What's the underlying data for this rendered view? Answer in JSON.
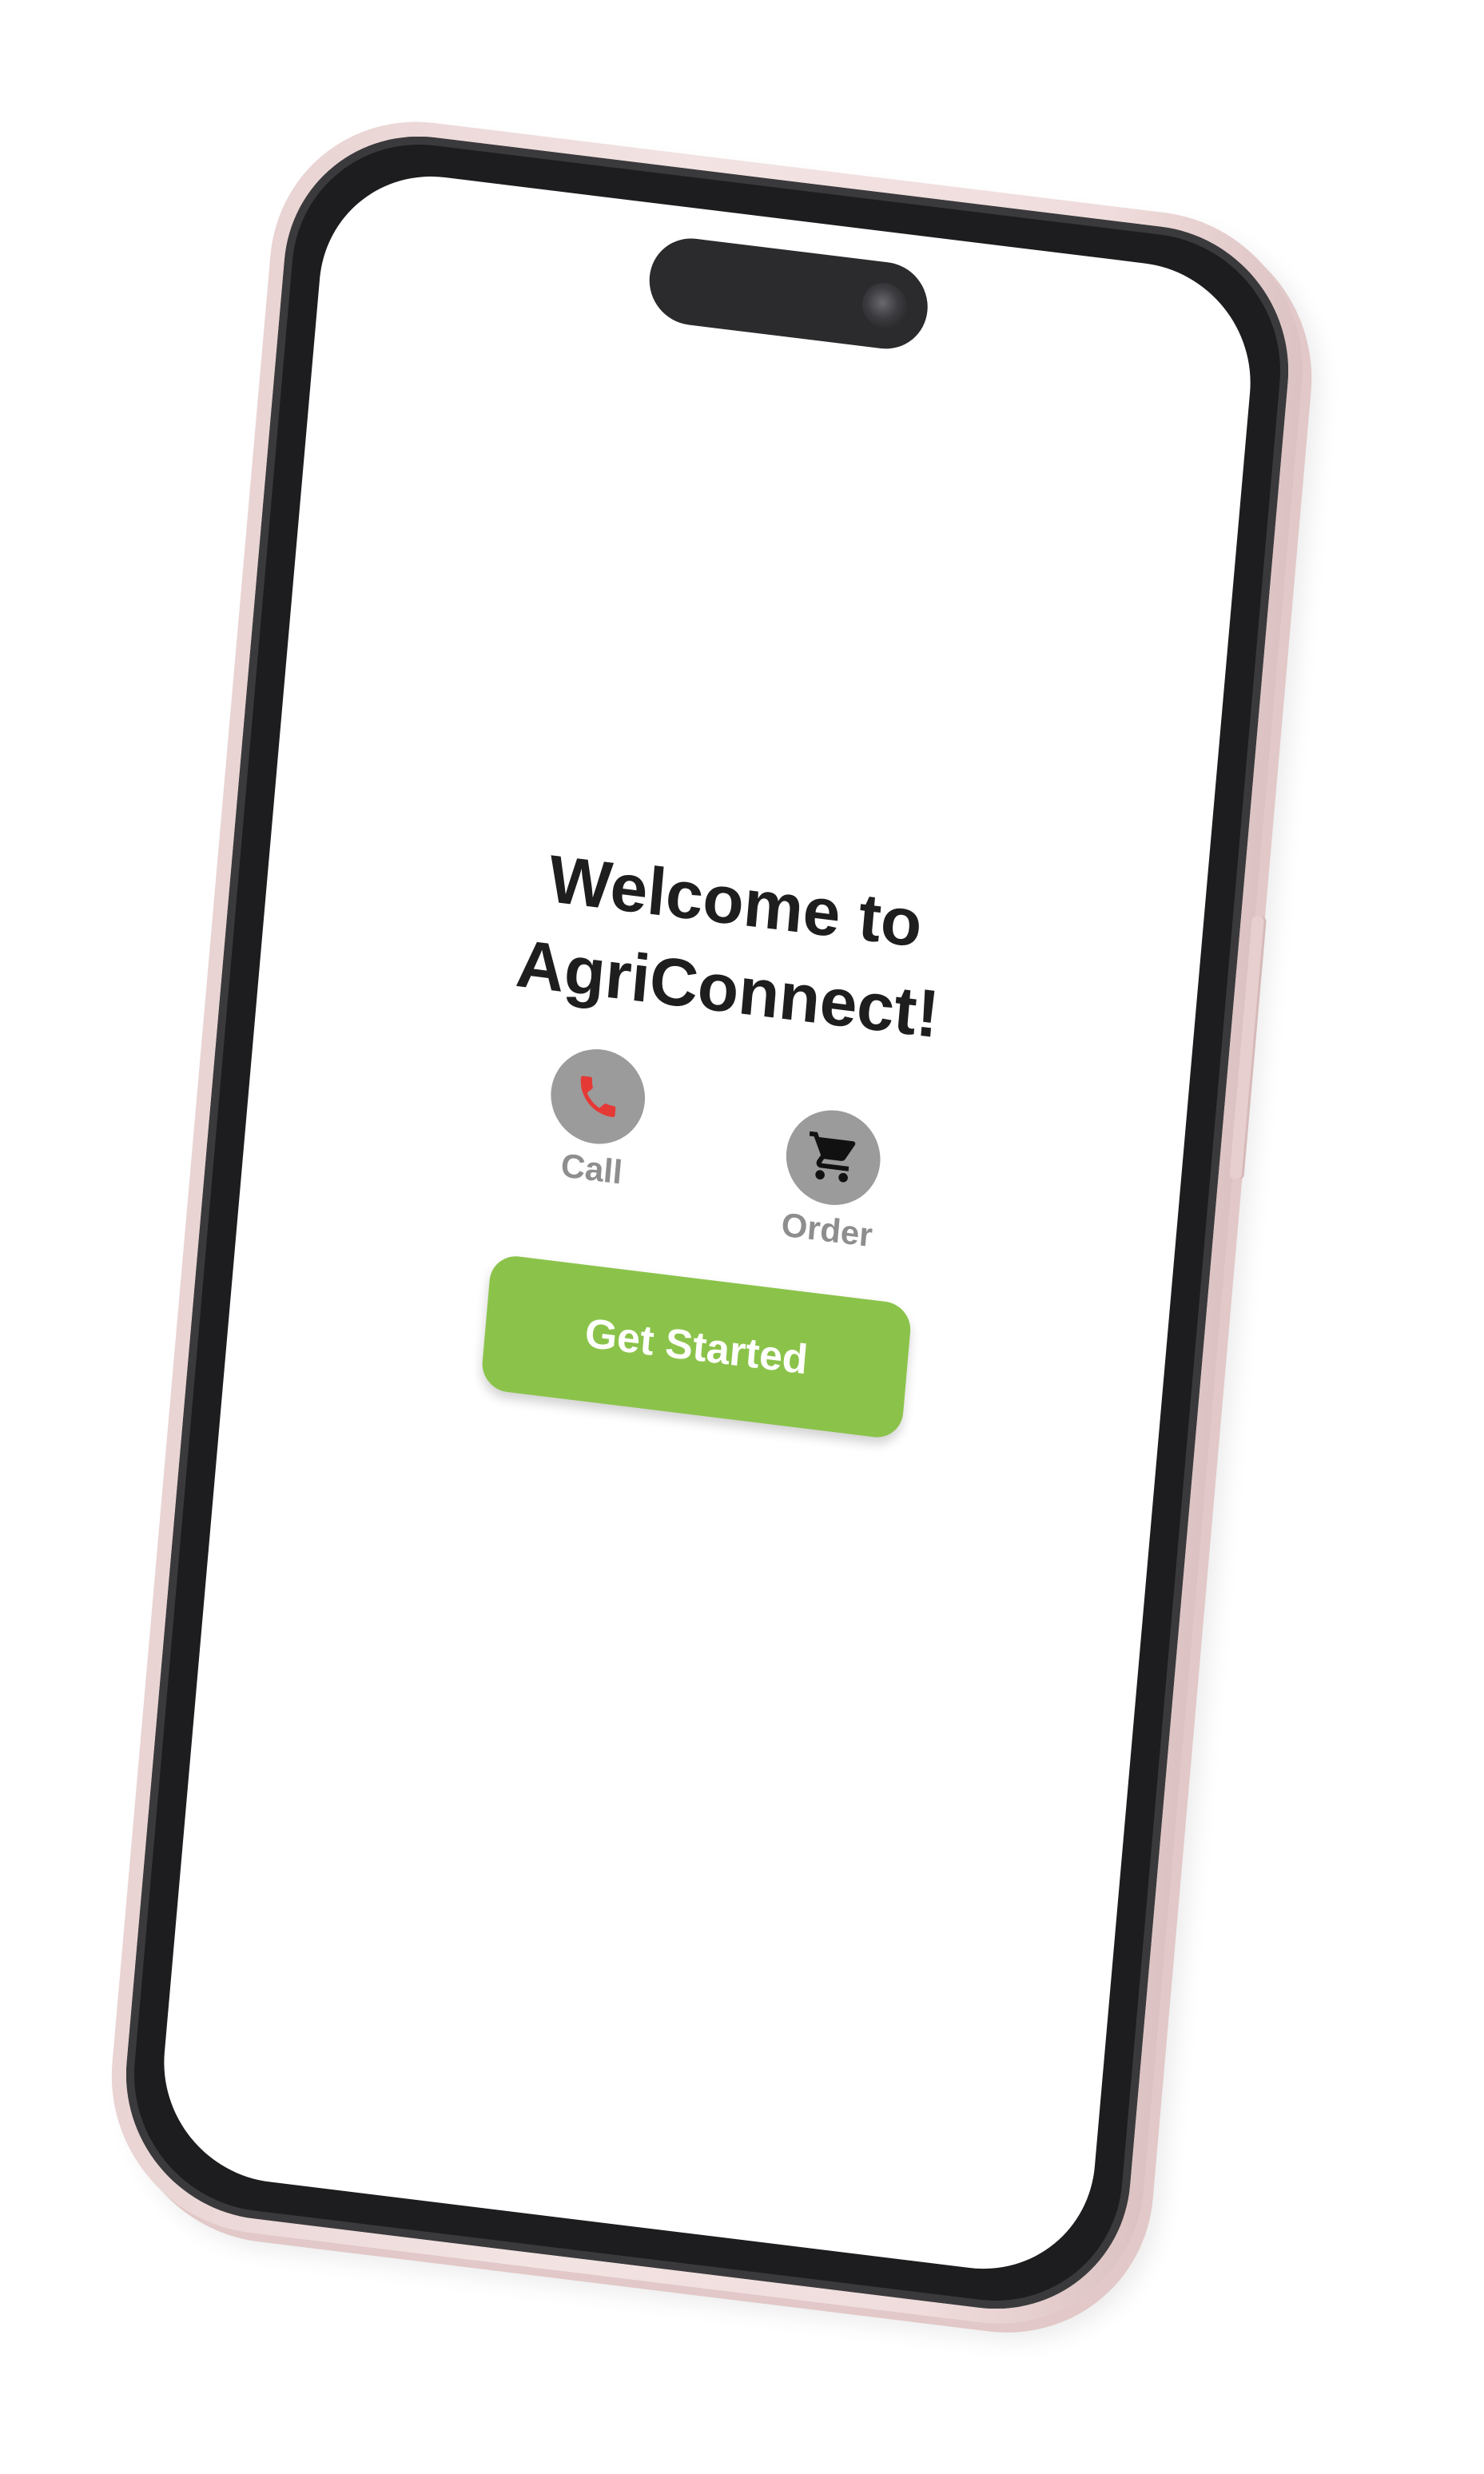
{
  "app": {
    "welcome_title": "Welcome to AgriConnect!"
  },
  "actions": {
    "call_label": "Call",
    "order_label": "Order",
    "call_icon": "phone-icon",
    "order_icon": "cart-icon"
  },
  "cta": {
    "get_started_label": "Get Started"
  },
  "colors": {
    "accent": "#8bc34a",
    "icon_circle": "#9b9b9b",
    "phone_icon": "#e53935",
    "cart_icon": "#111111",
    "label_gray": "#8e8e8e",
    "device_frame": "#f0dcdc"
  }
}
